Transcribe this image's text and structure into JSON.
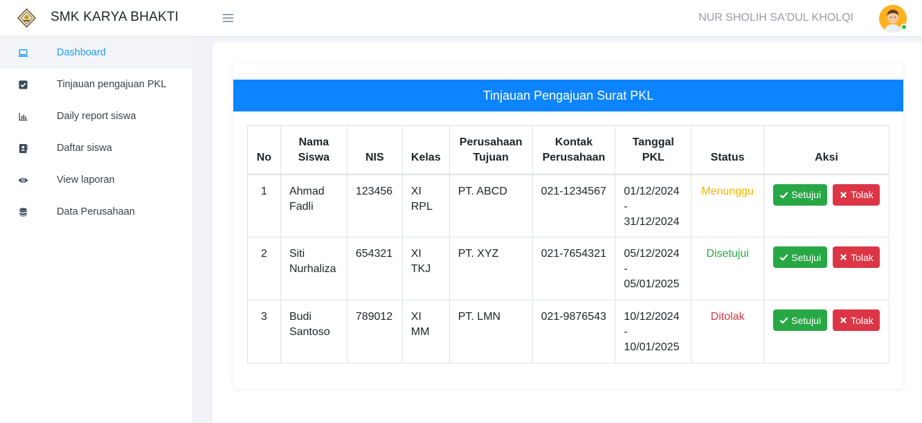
{
  "header": {
    "brand": "SMK KARYA BHAKTI",
    "user_name": "NUR SHOLIH SA'DUL KHOLQI"
  },
  "sidebar": {
    "items": [
      {
        "label": "Dashboard",
        "icon": "laptop-icon",
        "active": true
      },
      {
        "label": "Tinjauan pengajuan PKL",
        "icon": "check-square-icon"
      },
      {
        "label": "Daily report siswa",
        "icon": "bar-chart-icon"
      },
      {
        "label": "Daftar siswa",
        "icon": "address-book-icon"
      },
      {
        "label": "View laporan",
        "icon": "eye-icon"
      },
      {
        "label": "Data Perusahaan",
        "icon": "database-icon"
      }
    ]
  },
  "main": {
    "card_title": "Tinjauan Pengajuan Surat PKL",
    "table": {
      "headers": [
        "No",
        "Nama Siswa",
        "NIS",
        "Kelas",
        "Perusahaan Tujuan",
        "Kontak Perusahaan",
        "Tanggal PKL",
        "Status",
        "Aksi"
      ],
      "rows": [
        {
          "no": "1",
          "nama": "Ahmad Fadli",
          "nis": "123456",
          "kelas": "XI RPL",
          "perusahaan": "PT. ABCD",
          "kontak": "021-1234567",
          "tanggal": "01/12/2024 - 31/12/2024",
          "status": "Menunggu"
        },
        {
          "no": "2",
          "nama": "Siti Nurhaliza",
          "nis": "654321",
          "kelas": "XI TKJ",
          "perusahaan": "PT. XYZ",
          "kontak": "021-7654321",
          "tanggal": "05/12/2024 - 05/01/2025",
          "status": "Disetujui"
        },
        {
          "no": "3",
          "nama": "Budi Santoso",
          "nis": "789012",
          "kelas": "XI MM",
          "perusahaan": "PT. LMN",
          "kontak": "021-9876543",
          "tanggal": "10/12/2024 - 10/01/2025",
          "status": "Ditolak"
        }
      ],
      "approve_label": "Setujui",
      "reject_label": "Tolak"
    }
  },
  "colors": {
    "accent": "#0d84ff",
    "active_link": "#1e9ff2",
    "approve": "#28a745",
    "reject": "#dc3545",
    "pending": "#f4b400"
  }
}
